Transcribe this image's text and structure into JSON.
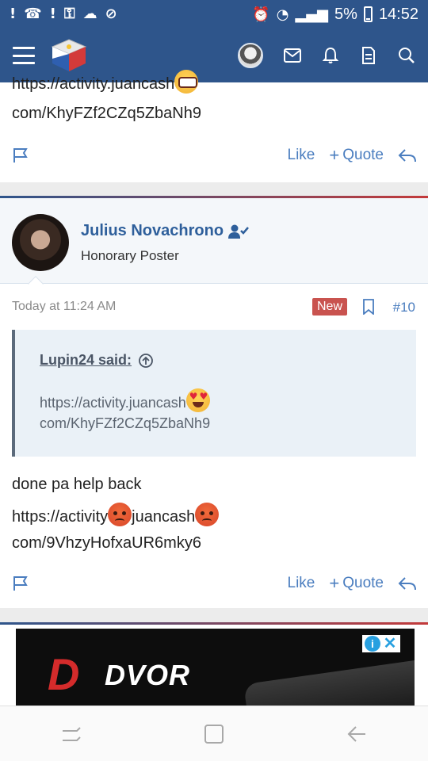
{
  "status_bar": {
    "battery": "5%",
    "time": "14:52"
  },
  "header": {
    "menu_icon": "hamburger-icon",
    "logo": "flag-cube-logo",
    "icons": [
      "avatar",
      "envelope-icon",
      "bell-icon",
      "document-icon",
      "search-icon"
    ]
  },
  "post_prev": {
    "line1": "https://activity.juancash",
    "line2": "com/KhyFZf2CZq5ZbaNh9",
    "actions": {
      "like": "Like",
      "quote": "Quote"
    }
  },
  "post": {
    "username": "Julius Novachrono",
    "user_title": "Honorary Poster",
    "timestamp": "Today at 11:24 AM",
    "badge": "New",
    "post_number": "#10",
    "quote": {
      "author": "Lupin24 said:",
      "line1": "https://activity.juancash",
      "line2": "com/KhyFZf2CZq5ZbaNh9"
    },
    "body": {
      "line1": "done pa help back",
      "line2a": "https://activity",
      "line2b": "juancash",
      "line3": "com/9VhzyHofxaUR6mky6"
    },
    "actions": {
      "like": "Like",
      "quote": "Quote"
    }
  },
  "ad": {
    "brand": "DVOR",
    "brand_mark": "D"
  },
  "nav": [
    "recent-apps-icon",
    "home-icon",
    "back-icon"
  ],
  "colors": {
    "header_bg": "#2e558b",
    "link": "#4a7dbf",
    "username": "#2e5f9b",
    "badge": "#c9534f"
  }
}
